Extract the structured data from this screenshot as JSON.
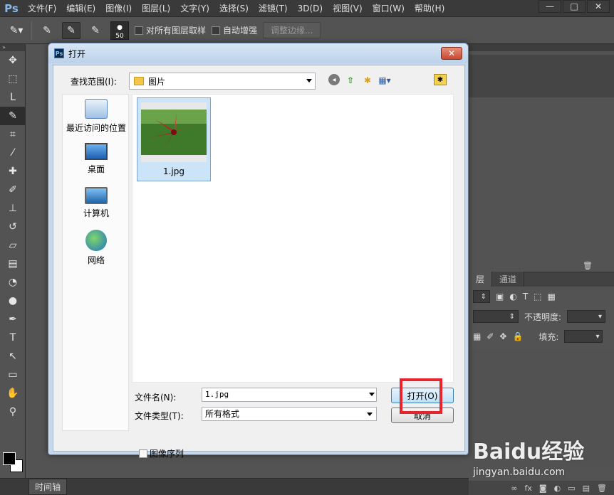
{
  "app": {
    "logo": "Ps"
  },
  "menu": [
    "文件(F)",
    "编辑(E)",
    "图像(I)",
    "图层(L)",
    "文字(Y)",
    "选择(S)",
    "滤镜(T)",
    "3D(D)",
    "视图(V)",
    "窗口(W)",
    "帮助(H)"
  ],
  "window_buttons": {
    "minimize": "—",
    "maximize": "□",
    "close": "✕"
  },
  "options": {
    "brush_size": "50",
    "sample_all_layers": "对所有图层取样",
    "auto_enhance": "自动增强",
    "refine_edge": "调整边缘..."
  },
  "dialog": {
    "title": "打开",
    "close": "✕",
    "look_in_label": "查找范围(I):",
    "look_in_value": "图片",
    "places": [
      {
        "label": "最近访问的位置",
        "icon": "recent-places-icon"
      },
      {
        "label": "桌面",
        "icon": "desktop-icon"
      },
      {
        "label": "计算机",
        "icon": "computer-icon"
      },
      {
        "label": "网络",
        "icon": "network-icon"
      }
    ],
    "files": [
      {
        "name": "1.jpg"
      }
    ],
    "filename_label": "文件名(N):",
    "filename_value": "1.jpg",
    "filetype_label": "文件类型(T):",
    "filetype_value": "所有格式",
    "open_button": "打开(O)",
    "cancel_button": "取消",
    "image_sequence": "图像序列"
  },
  "layers_panel": {
    "tabs": [
      "层",
      "通道"
    ],
    "opacity_label": "不透明度:",
    "fill_label": "填充:"
  },
  "status": {
    "timeline_tab": "时间轴"
  },
  "watermark": {
    "logo": "Baidu经验",
    "url": "jingyan.baidu.com"
  },
  "colors": {
    "highlight": "#e8232c",
    "ps_bg": "#535353"
  }
}
